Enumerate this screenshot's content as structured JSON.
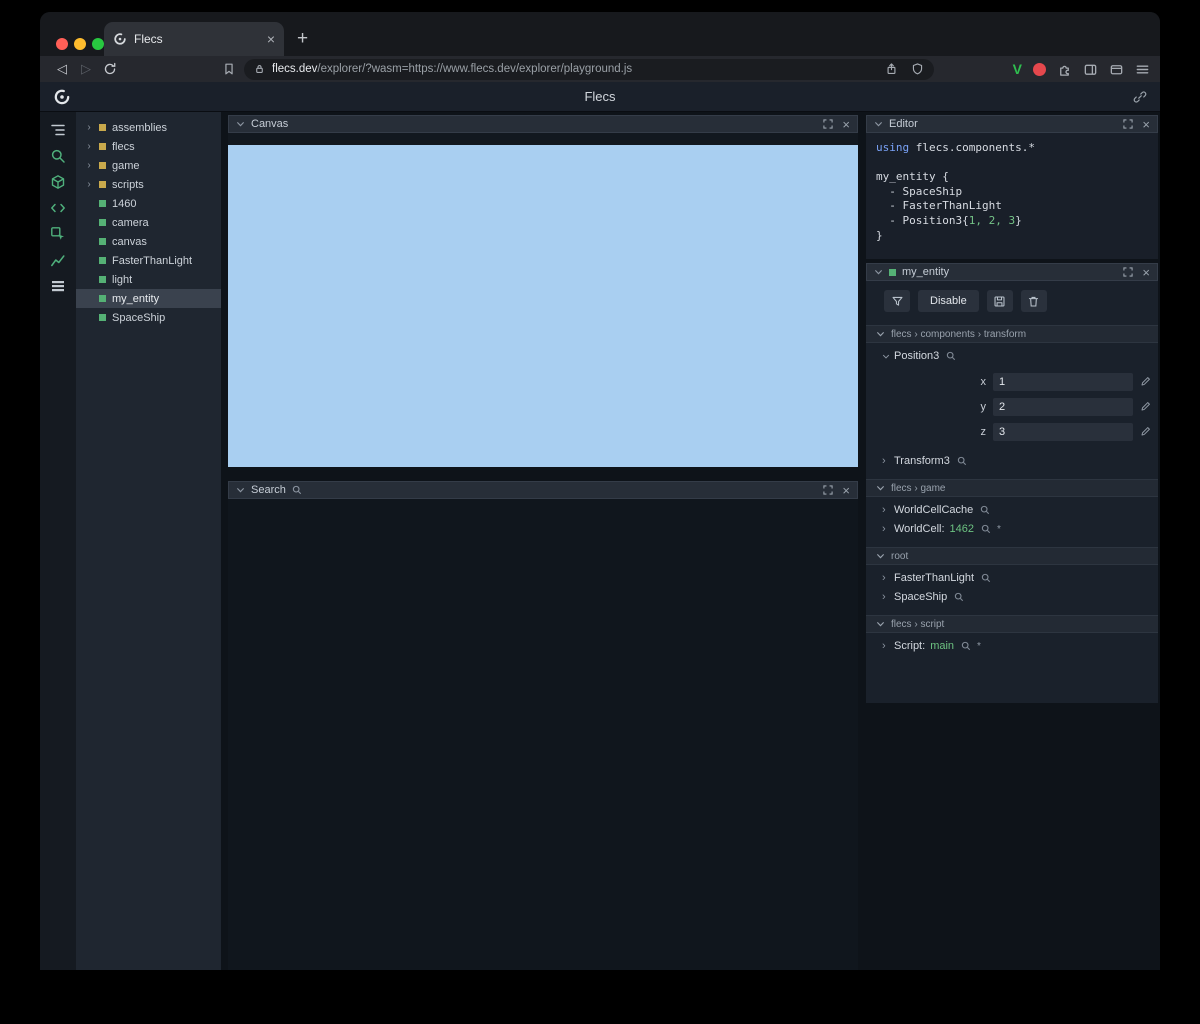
{
  "colors": {
    "accent_green": "#4fb07c",
    "module_yellow": "#c9a94c",
    "entity_green": "#55b175",
    "canvas_blue": "#a9cff1",
    "value_green": "#6cc281",
    "keyword_blue": "#7aa2f7",
    "brave_red": "#e5484d",
    "v_green": "#2fbe4f"
  },
  "icons": {
    "close": "×",
    "new_tab": "+",
    "back": "◁",
    "forward": "▷",
    "chevron_right": "›",
    "annotation": "*"
  },
  "browser": {
    "tab_title": "Flecs",
    "url_domain": "flecs.dev",
    "url_rest": "/explorer/?wasm=https://www.flecs.dev/explorer/playground.js",
    "v_label": "V"
  },
  "app": {
    "title": "Flecs"
  },
  "tree": {
    "items": [
      {
        "label": "assemblies",
        "type": "module"
      },
      {
        "label": "flecs",
        "type": "module"
      },
      {
        "label": "game",
        "type": "module"
      },
      {
        "label": "scripts",
        "type": "module"
      },
      {
        "label": "1460",
        "type": "entity"
      },
      {
        "label": "camera",
        "type": "entity"
      },
      {
        "label": "canvas",
        "type": "entity"
      },
      {
        "label": "FasterThanLight",
        "type": "entity"
      },
      {
        "label": "light",
        "type": "entity"
      },
      {
        "label": "my_entity",
        "type": "entity",
        "selected": true
      },
      {
        "label": "SpaceShip",
        "type": "entity"
      }
    ]
  },
  "panels": {
    "canvas": {
      "title": "Canvas"
    },
    "search": {
      "title": "Search"
    },
    "editor": {
      "title": "Editor"
    }
  },
  "editor_code": {
    "l1_kw": "using",
    "l1_rest": " flecs.components.*",
    "l3": "my_entity {",
    "l4": "  - SpaceShip",
    "l5": "  - FasterThanLight",
    "l6_pre": "  - Position3{",
    "l6_nums": "1, 2, 3",
    "l6_post": "}",
    "l7": "}"
  },
  "inspector": {
    "title": "my_entity",
    "toolbar": {
      "disable": "Disable"
    },
    "sections": [
      {
        "breadcrumb": "flecs › components › transform",
        "components": [
          {
            "name": "Position3",
            "fields": [
              {
                "label": "x",
                "value": "1"
              },
              {
                "label": "y",
                "value": "2"
              },
              {
                "label": "z",
                "value": "3"
              }
            ]
          },
          {
            "name": "Transform3"
          }
        ]
      },
      {
        "breadcrumb": "flecs › game",
        "components": [
          {
            "name": "WorldCellCache"
          },
          {
            "name": "WorldCell:",
            "value": "1462"
          }
        ]
      },
      {
        "breadcrumb": "root",
        "components": [
          {
            "name": "FasterThanLight"
          },
          {
            "name": "SpaceShip"
          }
        ]
      },
      {
        "breadcrumb": "flecs › script",
        "components": [
          {
            "name": "Script:",
            "value": "main"
          }
        ]
      }
    ]
  }
}
